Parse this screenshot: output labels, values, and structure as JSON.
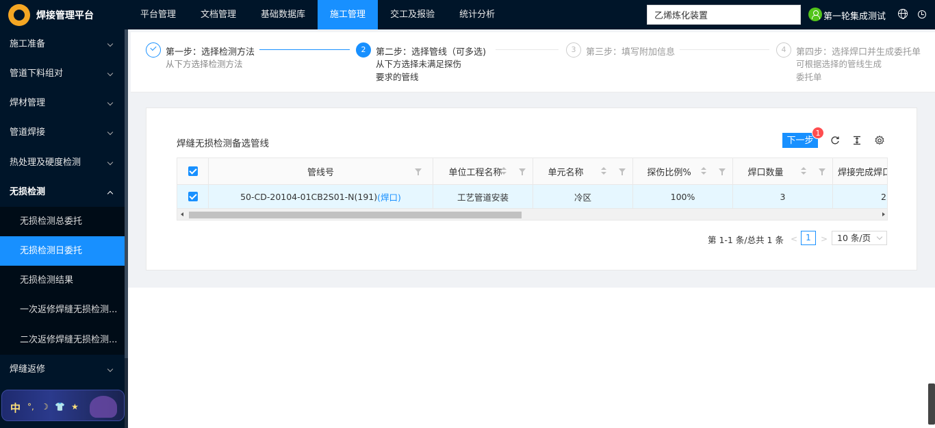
{
  "app": {
    "title": "焊接管理平台",
    "logo_icon": "logo-icon"
  },
  "nav": [
    {
      "label": "平台管理",
      "active": false
    },
    {
      "label": "文档管理",
      "active": false
    },
    {
      "label": "基础数据库",
      "active": false
    },
    {
      "label": "施工管理",
      "active": true
    },
    {
      "label": "交工及报验",
      "active": false
    },
    {
      "label": "统计分析",
      "active": false
    }
  ],
  "header": {
    "project_value": "乙烯炼化装置",
    "user_name": "第一轮集成测试"
  },
  "sidebar": {
    "menus": [
      {
        "label": "施工准备"
      },
      {
        "label": "管道下料组对"
      },
      {
        "label": "焊材管理"
      },
      {
        "label": "管道焊接"
      },
      {
        "label": "热处理及硬度检测"
      },
      {
        "label": "无损检测"
      },
      {
        "label": "焊缝返修"
      }
    ],
    "submenus": [
      {
        "label": "无损检测总委托"
      },
      {
        "label": "无损检测日委托"
      },
      {
        "label": "无损检测结果"
      },
      {
        "label": "一次返修焊缝无损检测..."
      },
      {
        "label": "二次返修焊缝无损检测..."
      }
    ]
  },
  "ime": {
    "text": "中",
    "symbols": [
      "°,",
      "☽",
      "👕",
      "★"
    ]
  },
  "steps": [
    {
      "title": "第一步：选择检测方法",
      "desc": "从下方选择检测方法",
      "status": "done"
    },
    {
      "number": "2",
      "title": "第二步：选择管线（可多选)",
      "desc": [
        "从下方选择未满足探伤",
        "要求的管线"
      ],
      "status": "active"
    },
    {
      "number": "3",
      "title": "第三步：填写附加信息",
      "desc": "",
      "status": "wait"
    },
    {
      "number": "4",
      "title": "第四步：选择焊口并生成委托单",
      "desc": [
        "可根据选择的管线生成",
        "委托单"
      ],
      "status": "wait"
    }
  ],
  "table": {
    "title": "焊缝无损检测备选管线",
    "next_label": "下一步",
    "badge_count": "1",
    "columns": [
      "管线号",
      "单位工程名称",
      "单元名称",
      "探伤比例%",
      "焊口数量",
      "焊接完成焊口"
    ],
    "rows": [
      {
        "pipeline": "50-CD-20104-01CB2S01-N(191)",
        "link": "(焊口)",
        "unit_project": "工艺管道安装",
        "unit_name": "冷区",
        "ratio": "100%",
        "weld_count": "3",
        "completed": "2"
      }
    ]
  },
  "pager": {
    "total": "第 1-1 条/总共 1 条",
    "page": "1",
    "page_size": "10 条/页",
    "prev": "<",
    "next": ">"
  },
  "colors": {
    "primary": "#1890ff",
    "sidebar_bg": "#001529",
    "danger": "#ff4d4f"
  }
}
